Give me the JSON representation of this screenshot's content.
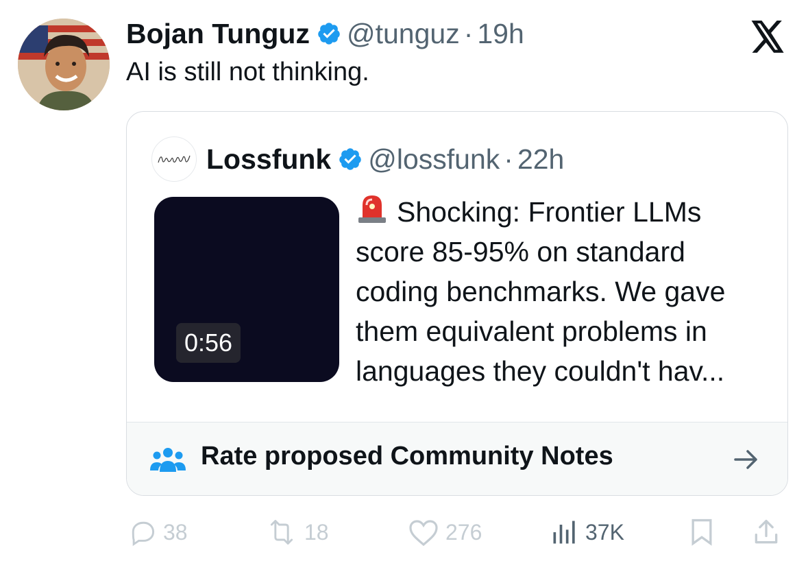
{
  "tweet": {
    "author": {
      "name": "Bojan Tunguz",
      "handle": "@tunguz",
      "time": "19h",
      "verified": true
    },
    "separator": "·",
    "text": "AI is still not thinking."
  },
  "quoted_tweet": {
    "author": {
      "name": "Lossfunk",
      "handle": "@lossfunk",
      "time": "22h",
      "verified": true
    },
    "separator": "·",
    "video_duration": "0:56",
    "text": "Shocking: Frontier LLMs score 85-95% on standard coding benchmarks. We gave them equivalent problems in languages they couldn't hav...",
    "community_notes_label": "Rate proposed Community Notes"
  },
  "actions": {
    "replies": "38",
    "reposts": "18",
    "likes": "276",
    "views": "37K"
  },
  "colors": {
    "verified_blue": "#1d9bf0",
    "muted_text": "#536471",
    "faded_action": "#c5cdd3"
  },
  "icons": [
    "x-logo-icon",
    "verified-badge-icon",
    "siren-emoji-icon",
    "community-icon",
    "arrow-right-icon",
    "reply-icon",
    "repost-icon",
    "like-icon",
    "views-icon",
    "bookmark-icon",
    "share-icon"
  ]
}
